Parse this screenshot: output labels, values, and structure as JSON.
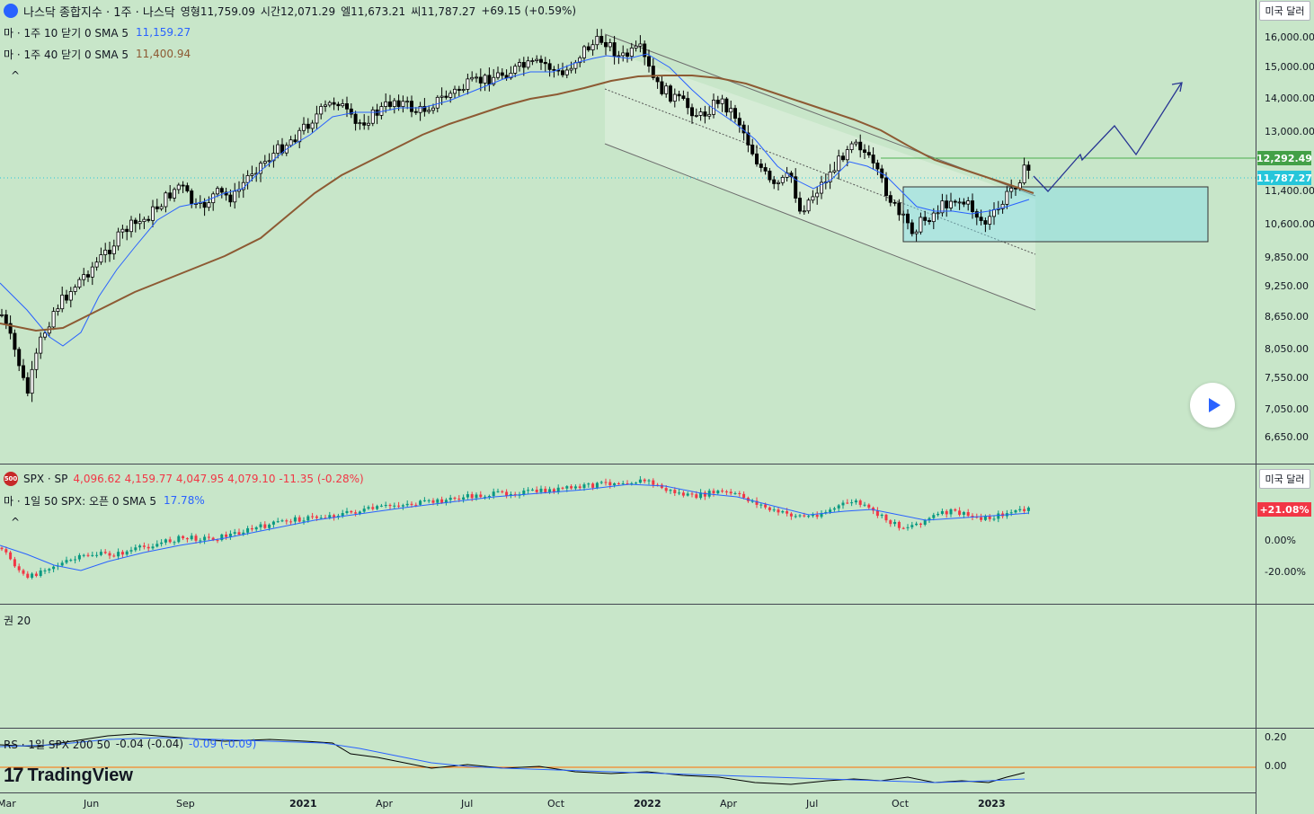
{
  "main_legend": {
    "title": "나스닥 종합지수 · 1주 · 나스닥",
    "open": "영형11,759.09",
    "high": "시간12,071.29",
    "low": "엘11,673.21",
    "close": "씨11,787.27",
    "change": "+69.15 (+0.59%)",
    "ma10_label": "마 · 1주 10 닫기 0 SMA 5",
    "ma10_value": "11,159.27",
    "ma40_label": "마 · 1주 40 닫기 0 SMA 5",
    "ma40_value": "11,400.94",
    "collapse": "^"
  },
  "spx_legend": {
    "icon_text": "500",
    "title": "SPX · SP",
    "ohlc": "4,096.62  4,159.77  4,047.95  4,079.10  -11.35 (-0.28%)",
    "ma_label": "마 · 1일 50 SPX: 오픈 0 SMA 5",
    "ma_value": "17.78%",
    "collapse": "^"
  },
  "empty_pane_label": "권 20",
  "rs_legend": {
    "label": "RS · 1일 SPX 200 50",
    "v1": "-0.04 (-0.04)",
    "v2": "-0.09 (-0.09)"
  },
  "currency_button": "미국 달러",
  "main_price_axis": [
    "16,000.00",
    "15,000.00",
    "14,000.00",
    "13,000.00",
    "11,400.00",
    "10,600.00",
    "9,850.00",
    "9,250.00",
    "8,650.00",
    "8,050.00",
    "7,550.00",
    "7,050.00",
    "6,650.00"
  ],
  "main_price_tags": {
    "level": "12,292.49",
    "last": "11,787.27"
  },
  "spx_axis": [
    "0.00%",
    "-20.00%"
  ],
  "spx_tag": "+21.08%",
  "rs_axis": [
    "0.20",
    "0.00"
  ],
  "time_axis": [
    "Mar",
    "Jun",
    "Sep",
    "2021",
    "Apr",
    "Jul",
    "Oct",
    "2022",
    "Apr",
    "Jul",
    "Oct",
    "2023"
  ],
  "logo_text": "TradingView",
  "colors": {
    "background": "#c8e6c9",
    "ma10": "#2962ff",
    "ma40": "#8d5a33",
    "spx_up": "#089981",
    "spx_down": "#f23645",
    "level_line": "#4caf50",
    "last_price": "#26c6da",
    "projection": "#283593",
    "zone_fill": "#80deea"
  },
  "chart_data": {
    "type": "candlestick",
    "timeframe": "1W",
    "series": [
      {
        "name": "나스닥 종합지수",
        "values": []
      },
      {
        "name": "SMA 10",
        "last": 11159.27
      },
      {
        "name": "SMA 40",
        "last": 11400.94
      }
    ],
    "last_ohlc": {
      "open": 11759.09,
      "high": 12071.29,
      "low": 11673.21,
      "close": 11787.27
    },
    "marked_level": 12292.49,
    "y_scale": "log",
    "grid": false
  }
}
